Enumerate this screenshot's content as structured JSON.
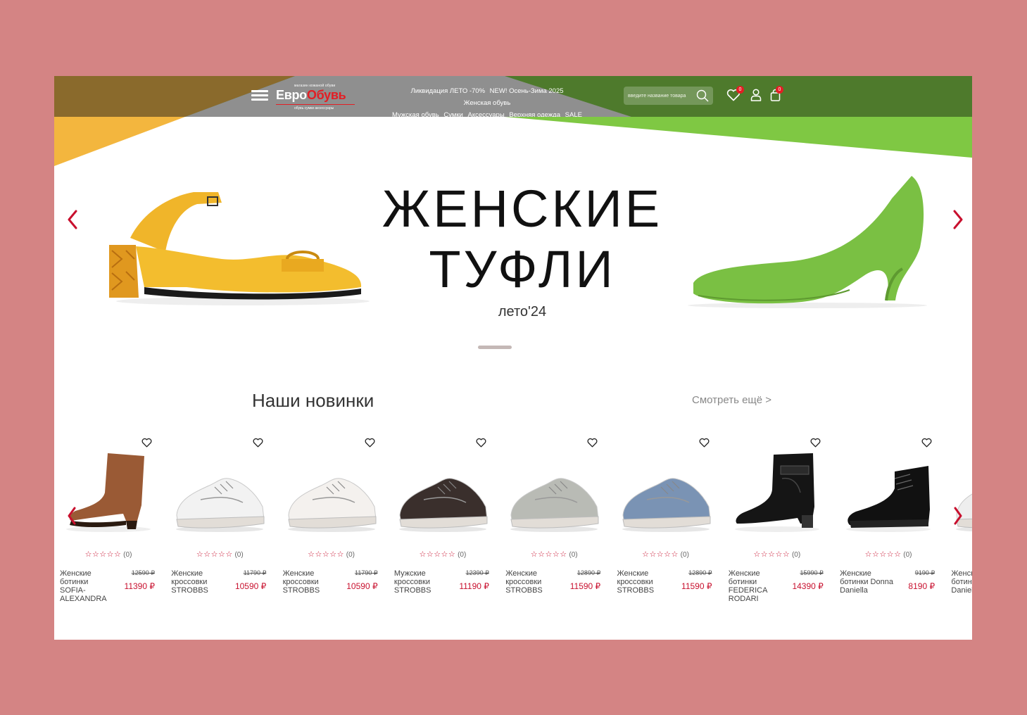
{
  "header": {
    "logo_tagline": "магазин кожаной обуви",
    "logo_part1": "Евро",
    "logo_part2": "Обувь",
    "logo_sub": "обувь сумки аксессуары",
    "nav_items": [
      "Ликвидация ЛЕТО -70%",
      "NEW! Осень-Зима 2025",
      "Женская обувь",
      "Мужская обувь",
      "Сумки",
      "Аксессуары",
      "Верхняя одежда",
      "SALE"
    ],
    "search_placeholder": "введите название товара",
    "favorites_count": "0",
    "cart_count": "0"
  },
  "hero": {
    "title_line1": "ЖЕНСКИЕ",
    "title_line2": "ТУФЛИ",
    "subtitle": "лето'24"
  },
  "new_section": {
    "title": "Наши новинки",
    "see_more": "Смотреть ещё >"
  },
  "products": [
    {
      "name": "Женские ботинки SOFIA-ALEXANDRA",
      "old_price": "12590 ₽",
      "price": "11390 ₽",
      "rating": "(0)",
      "kind": "cowboy",
      "color": "#9a5a35"
    },
    {
      "name": "Женские кроссовки STROBBS",
      "old_price": "11790 ₽",
      "price": "10590 ₽",
      "rating": "(0)",
      "kind": "sneaker",
      "color": "#f2f2f2"
    },
    {
      "name": "Женские кроссовки STROBBS",
      "old_price": "11790 ₽",
      "price": "10590 ₽",
      "rating": "(0)",
      "kind": "sneaker",
      "color": "#f4f1ee"
    },
    {
      "name": "Мужские кроссовки STROBBS",
      "old_price": "12390 ₽",
      "price": "11190 ₽",
      "rating": "(0)",
      "kind": "sneaker",
      "color": "#3a2f2c"
    },
    {
      "name": "Женские кроссовки STROBBS",
      "old_price": "12890 ₽",
      "price": "11590 ₽",
      "rating": "(0)",
      "kind": "sneaker",
      "color": "#b9bbb5"
    },
    {
      "name": "Женские кроссовки STROBBS",
      "old_price": "12890 ₽",
      "price": "11590 ₽",
      "rating": "(0)",
      "kind": "sneaker",
      "color": "#7a93b4"
    },
    {
      "name": "Женские ботинки FEDERICA RODARI",
      "old_price": "15990 ₽",
      "price": "14390 ₽",
      "rating": "(0)",
      "kind": "boot",
      "color": "#151515"
    },
    {
      "name": "Женские ботинки Donna Daniella",
      "old_price": "9190 ₽",
      "price": "8190 ₽",
      "rating": "(0)",
      "kind": "ankle",
      "color": "#111111"
    },
    {
      "name": "Женские ботинки basic Daniella",
      "old_price": "",
      "price": "",
      "rating": "",
      "kind": "sneaker",
      "color": "#eeeeee"
    }
  ],
  "colors": {
    "accent": "#c8102e",
    "header_olive": "#8a6a2c",
    "header_green": "#4e7a2c",
    "lime": "#7fc843",
    "yellow": "#f3b63e",
    "background": "#d48484"
  }
}
